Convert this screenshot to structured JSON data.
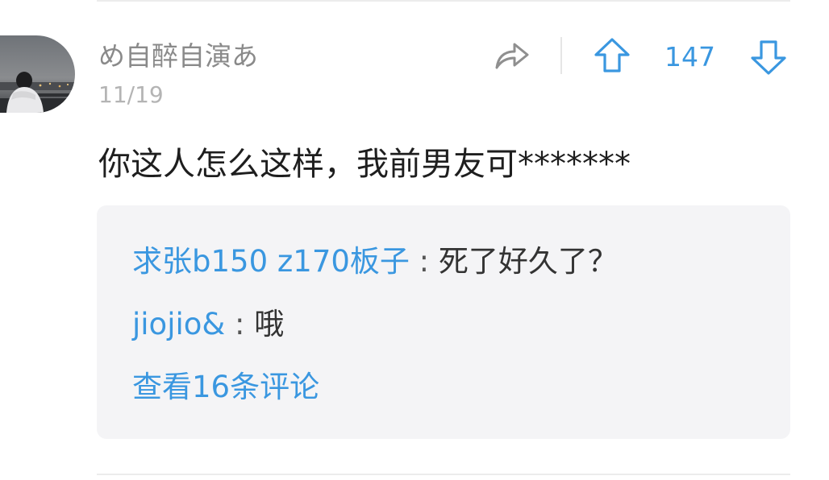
{
  "comment": {
    "username": "め自醉自演あ",
    "timestamp": "11/19",
    "body": "你这人怎么这样，我前男友可*******",
    "vote_count": "147",
    "icons": {
      "avatar": "user-avatar",
      "share": "share-arrow-icon",
      "upvote": "upvote-arrow-icon",
      "downvote": "downvote-arrow-icon"
    }
  },
  "replies": [
    {
      "user": "求张b150 z170板子",
      "separator": " : ",
      "text": "死了好久了？"
    },
    {
      "user": "jiojio&",
      "separator": " : ",
      "text": "哦"
    }
  ],
  "view_more": "查看16条评论",
  "colors": {
    "accent": "#3a97e0",
    "username": "#8a8a8a",
    "timestamp": "#b4b4b4",
    "body": "#1e1e1e",
    "reply_bg": "#f4f4f6"
  }
}
